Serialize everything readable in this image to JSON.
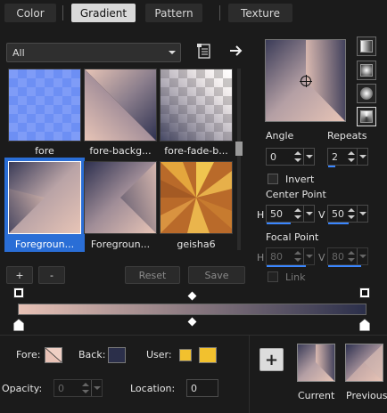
{
  "tabs": [
    {
      "label": "Color",
      "active": false
    },
    {
      "label": "Gradient",
      "active": true
    },
    {
      "label": "Pattern",
      "active": false
    },
    {
      "label": "Texture",
      "active": false
    }
  ],
  "category": {
    "selected": "All"
  },
  "library": {
    "items": [
      {
        "label": "fore"
      },
      {
        "label": "fore-backg..."
      },
      {
        "label": "fore-fade-b..."
      },
      {
        "label": "Foregroun...",
        "selected": true
      },
      {
        "label": "Foregroun..."
      },
      {
        "label": "geisha6"
      }
    ]
  },
  "library_buttons": {
    "add": "+",
    "remove": "-",
    "reset": "Reset",
    "save": "Save"
  },
  "angle": {
    "label": "Angle",
    "value": "0"
  },
  "repeats": {
    "label": "Repeats",
    "value": "2"
  },
  "invert": {
    "label": "Invert",
    "checked": false
  },
  "center_point": {
    "label": "Center Point",
    "h_label": "H",
    "h": "50",
    "v_label": "V",
    "v": "50"
  },
  "focal_point": {
    "label": "Focal Point",
    "h_label": "H",
    "h": "80",
    "v_label": "V",
    "v": "80",
    "link_label": "Link"
  },
  "bottom": {
    "fore_label": "Fore:",
    "back_label": "Back:",
    "user_label": "User:",
    "opacity_label": "Opacity:",
    "opacity_value": "0",
    "location_label": "Location:",
    "location_value": "0",
    "add_button": "+",
    "current_label": "Current",
    "previous_label": "Previous"
  },
  "colors": {
    "accent": "#3a86ff",
    "fore": "#e8c2b6",
    "back": "#2b2f4a",
    "user": "#f2c12e"
  }
}
